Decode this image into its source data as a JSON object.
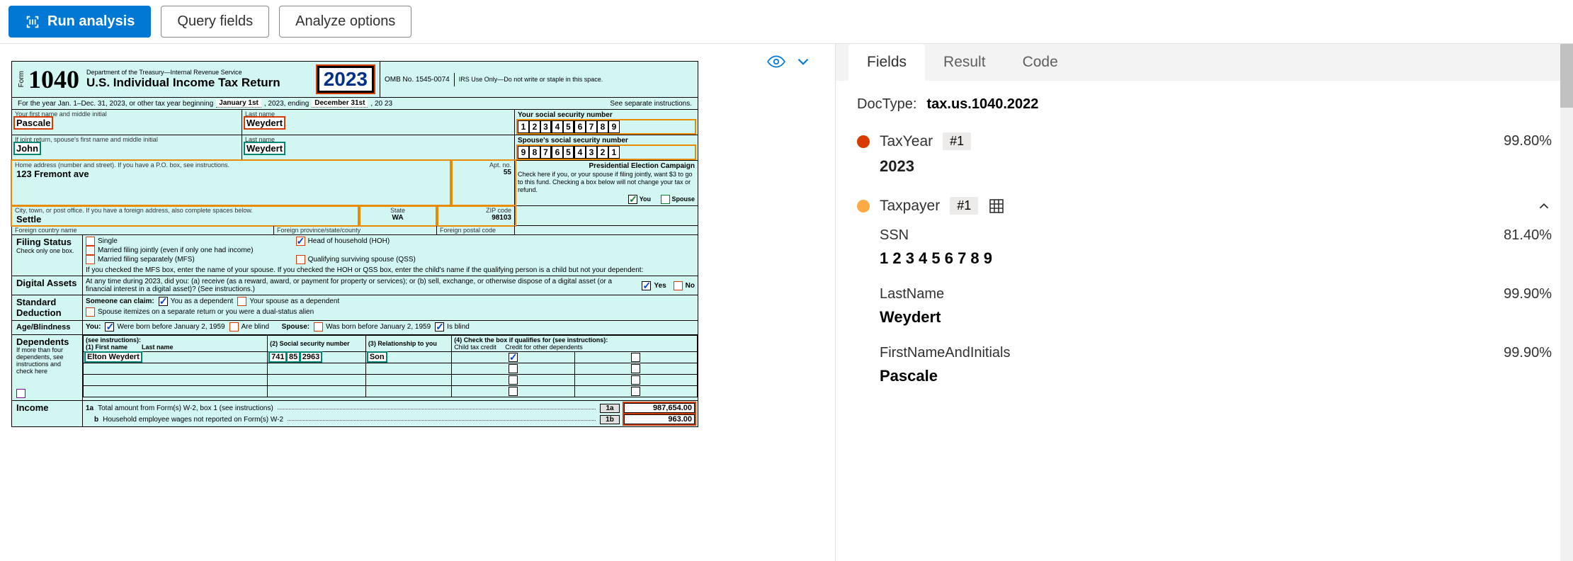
{
  "toolbar": {
    "run_label": "Run analysis",
    "query_label": "Query fields",
    "analyze_label": "Analyze options"
  },
  "tabs": {
    "fields": "Fields",
    "result": "Result",
    "code": "Code"
  },
  "doctype": {
    "label": "DocType:",
    "value": "tax.us.1040.2022"
  },
  "fields": {
    "taxyear": {
      "name": "TaxYear",
      "badge": "#1",
      "conf": "99.80%",
      "value": "2023"
    },
    "taxpayer": {
      "name": "Taxpayer",
      "badge": "#1",
      "ssn": {
        "name": "SSN",
        "conf": "81.40%",
        "value": "1 2 3 4 5 6 7 8 9"
      },
      "last": {
        "name": "LastName",
        "conf": "99.90%",
        "value": "Weydert"
      },
      "first": {
        "name": "FirstNameAndInitials",
        "conf": "99.90%",
        "value": "Pascale"
      }
    }
  },
  "form": {
    "formnum": "1040",
    "dept": "Department of the Treasury—Internal Revenue Service",
    "title": "U.S. Individual Income Tax Return",
    "year": "2023",
    "omb": "OMB No. 1545-0074",
    "irsuse": "IRS Use Only—Do not write or staple in this space.",
    "period_prefix": "For the year Jan. 1–Dec. 31, 2023, or other tax year beginning",
    "begin_date": "January 1st",
    "ending_word": ", 2023, ending",
    "end_date": "December 31st",
    "end_year": ", 20 23",
    "see_instr": "See separate instructions.",
    "first_lbl": "Your first name and middle initial",
    "first_val": "Pascale",
    "last_lbl": "Last name",
    "last_val": "Weydert",
    "ssn_lbl": "Your social security number",
    "ssn_digits": [
      "1",
      "2",
      "3",
      "4",
      "5",
      "6",
      "7",
      "8",
      "9"
    ],
    "sp_first_lbl": "If joint return, spouse's first name and middle initial",
    "sp_first_val": "John",
    "sp_last_lbl": "Last name",
    "sp_last_val": "Weydert",
    "sp_ssn_lbl": "Spouse's social security number",
    "sp_ssn_digits": [
      "9",
      "8",
      "7",
      "6",
      "5",
      "4",
      "3",
      "2",
      "1"
    ],
    "addr_lbl": "Home address (number and street). If you have a P.O. box, see instructions.",
    "addr_val": "123 Fremont ave",
    "apt_lbl": "Apt. no.",
    "apt_val": "55",
    "city_lbl": "City, town, or post office. If you have a foreign address, also complete spaces below.",
    "city_val": "Settle",
    "state_lbl": "State",
    "state_val": "WA",
    "zip_lbl": "ZIP code",
    "zip_val": "98103",
    "f_country": "Foreign country name",
    "f_prov": "Foreign province/state/county",
    "f_postal": "Foreign postal code",
    "pec_hd": "Presidential Election Campaign",
    "pec_txt": "Check here if you, or your spouse if filing jointly, want $3 to go to this fund. Checking a box below will not change your tax or refund.",
    "pec_you": "You",
    "pec_spouse": "Spouse",
    "fs_label": "Filing Status",
    "fs_sub": "Check only one box.",
    "fs_single": "Single",
    "fs_mfj": "Married filing jointly (even if only one had income)",
    "fs_mfs": "Married filing separately (MFS)",
    "fs_hoh": "Head of household (HOH)",
    "fs_qss": "Qualifying surviving spouse (QSS)",
    "fs_note": "If you checked the MFS box, enter the name of your spouse. If you checked the HOH or QSS box, enter the child's name if the qualifying person is a child but not your dependent:",
    "da_label": "Digital Assets",
    "da_txt": "At any time during 2023, did you: (a) receive (as a reward, award, or payment for property or services); or (b) sell, exchange, or otherwise dispose of a digital asset (or a financial interest in a digital asset)? (See instructions.)",
    "da_yes": "Yes",
    "da_no": "No",
    "sd_label": "Standard Deduction",
    "sd_txt1": "Someone can claim:",
    "sd_opt1": "You as a dependent",
    "sd_opt2": "Your spouse as a dependent",
    "sd_txt2": "Spouse itemizes on a separate return or you were a dual-status alien",
    "ab_label": "Age/Blindness",
    "ab_you": "You:",
    "ab_sp": "Spouse:",
    "ab_born": "Were born before January 2, 1959",
    "ab_blind": "Are blind",
    "ab_sp_born": "Was born before January 2, 1959",
    "ab_sp_blind": "Is blind",
    "dep_label": "Dependents",
    "dep_instr": "(see instructions):",
    "dep_more": "If more than four dependents, see instructions and check here",
    "dep_c1": "(1) First name",
    "dep_c1b": "Last name",
    "dep_c2": "(2) Social security number",
    "dep_c3": "(3) Relationship to you",
    "dep_c4": "(4) Check the box if qualifies for (see instructions):",
    "dep_c4a": "Child tax credit",
    "dep_c4b": "Credit for other dependents",
    "dep1_name": "Elton Weydert",
    "dep1_ssn_a": "741",
    "dep1_ssn_b": "85",
    "dep1_ssn_c": "2963",
    "dep1_rel": "Son",
    "inc_label": "Income",
    "inc_1a": "1a",
    "inc_1a_txt": "Total amount from Form(s) W-2, box 1 (see instructions)",
    "inc_1a_amt": "987,654.00",
    "inc_b": "b",
    "inc_b_txt": "Household employee wages not reported on Form(s) W-2",
    "inc_1b_box": "1b",
    "inc_b_amt": "963.00"
  }
}
